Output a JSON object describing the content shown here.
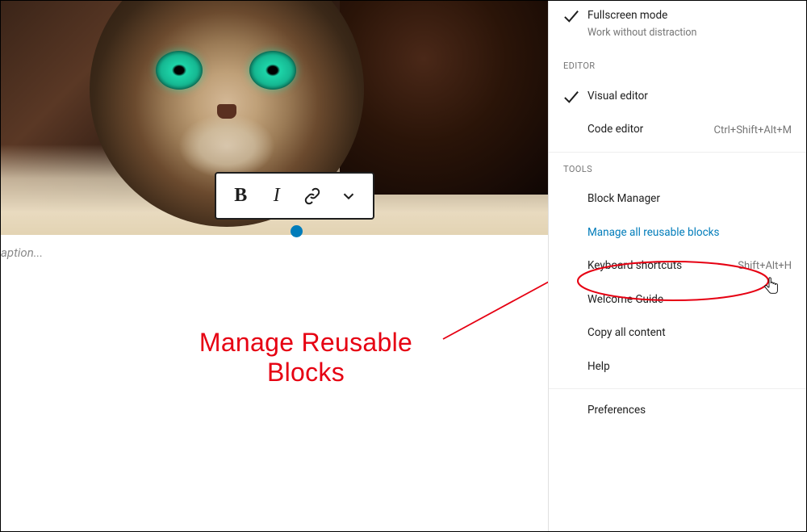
{
  "editor": {
    "caption_placeholder": "aption...",
    "toolbar": {
      "bold": "B",
      "italic": "I"
    }
  },
  "annotation": {
    "label_line1": "Manage Reusable",
    "label_line2": "Blocks"
  },
  "menu": {
    "view": {
      "fullscreen": {
        "title": "Fullscreen mode",
        "sub": "Work without distraction"
      }
    },
    "editor": {
      "header": "EDITOR",
      "visual": "Visual editor",
      "code": {
        "label": "Code editor",
        "shortcut": "Ctrl+Shift+Alt+M"
      }
    },
    "tools": {
      "header": "TOOLS",
      "block_manager": "Block Manager",
      "manage_reusable": "Manage all reusable blocks",
      "keyboard_shortcuts": {
        "label": "Keyboard shortcuts",
        "shortcut": "Shift+Alt+H"
      },
      "welcome_guide": "Welcome Guide",
      "copy_all": "Copy all content",
      "help": "Help"
    },
    "preferences": "Preferences"
  }
}
